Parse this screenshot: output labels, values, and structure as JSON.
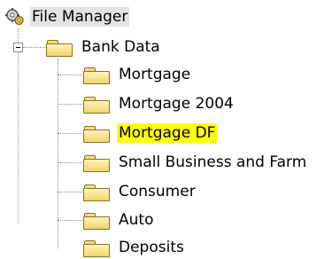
{
  "tree": {
    "root": {
      "label": "File Manager",
      "icon": "file-manager-gears-icon"
    },
    "bank_data": {
      "label": "Bank Data",
      "icon": "folder-icon",
      "expanded": true,
      "children": [
        {
          "label": "Mortgage",
          "icon": "folder-icon",
          "selected": false
        },
        {
          "label": "Mortgage 2004",
          "icon": "folder-icon",
          "selected": false
        },
        {
          "label": "Mortgage DF",
          "icon": "folder-icon",
          "selected": true
        },
        {
          "label": "Small Business and Farm",
          "icon": "folder-icon",
          "selected": false
        },
        {
          "label": "Consumer",
          "icon": "folder-icon",
          "selected": false
        },
        {
          "label": "Auto",
          "icon": "folder-icon",
          "selected": false
        },
        {
          "label": "Deposits",
          "icon": "folder-icon",
          "selected": false
        }
      ]
    }
  },
  "colors": {
    "selection_highlight": "#ffff00",
    "root_highlight": "#e3e3e3",
    "folder_fill": "#f2d46a",
    "connector": "#8a8a8a"
  }
}
